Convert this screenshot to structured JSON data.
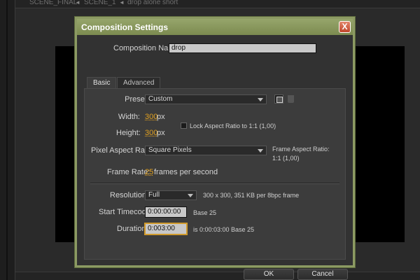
{
  "background": {
    "tabs": [
      "SCENE_FINAL",
      "SCENE_1",
      "drop alone short"
    ]
  },
  "dialog": {
    "title": "Composition Settings",
    "close_label": "X",
    "composition_name_label": "Composition Name:",
    "composition_name_value": "drop",
    "tabs": [
      {
        "label": "Basic",
        "active": true
      },
      {
        "label": "Advanced",
        "active": false
      }
    ],
    "preset": {
      "label": "Preset:",
      "value": "Custom"
    },
    "width": {
      "label": "Width:",
      "value": "300",
      "unit": "px"
    },
    "height": {
      "label": "Height:",
      "value": "300",
      "unit": "px"
    },
    "lock_aspect_label": "Lock Aspect Ratio to 1:1 (1,00)",
    "pixel_aspect": {
      "label": "Pixel Aspect Ratio:",
      "value": "Square Pixels"
    },
    "frame_aspect": {
      "label": "Frame Aspect Ratio:",
      "value": "1:1 (1,00)"
    },
    "frame_rate": {
      "label": "Frame Rate:",
      "value": "25",
      "suffix": "frames per second"
    },
    "resolution": {
      "label": "Resolution:",
      "value": "Full",
      "info": "300 x 300, 351 KB per 8bpc frame"
    },
    "start_timecode": {
      "label": "Start Timecode:",
      "value": "0:00:00:00",
      "base": "Base 25"
    },
    "duration": {
      "label": "Duration:",
      "value": "0:003:00",
      "info": "is 0:00:03:00  Base 25"
    },
    "ok_label": "OK",
    "cancel_label": "Cancel"
  },
  "colors": {
    "title_bar": "#8c9a63",
    "accent_value": "#e0a020",
    "close_button": "#c0462b"
  }
}
